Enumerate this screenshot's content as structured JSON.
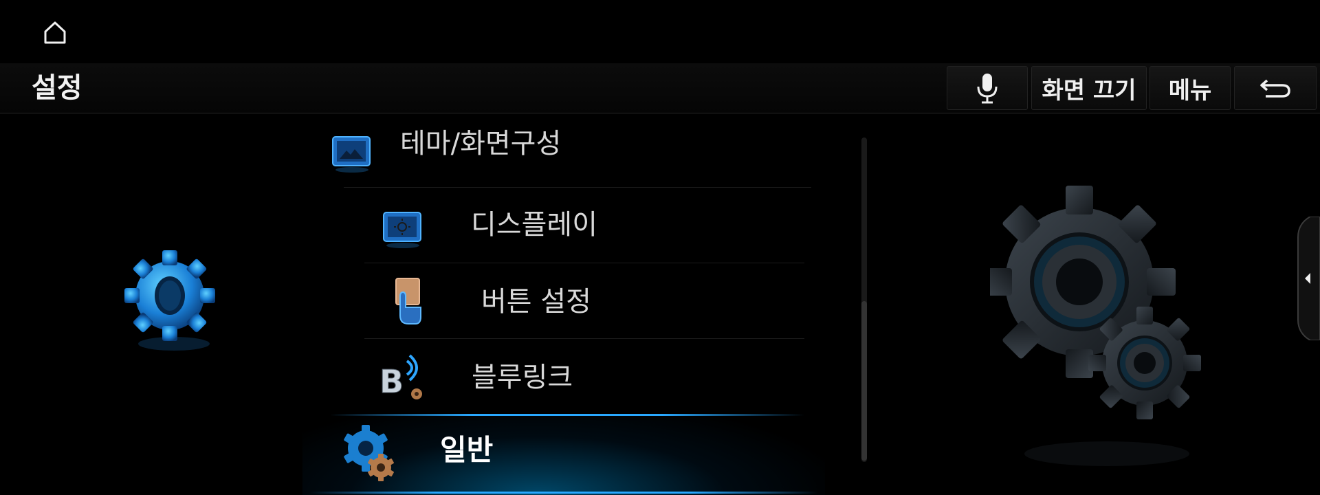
{
  "topbar": {
    "home_icon": "home-icon"
  },
  "header": {
    "title": "설정",
    "buttons": {
      "mic_icon": "microphone-icon",
      "screen_off_label": "화면 끄기",
      "menu_label": "메뉴",
      "back_icon": "back-arrow-icon"
    }
  },
  "menu": {
    "items": [
      {
        "label": "테마/화면구성",
        "icon": "theme-layout-icon"
      },
      {
        "label": "디스플레이",
        "icon": "display-icon"
      },
      {
        "label": "버튼 설정",
        "icon": "button-settings-icon"
      },
      {
        "label": "블루링크",
        "icon": "bluelink-icon"
      },
      {
        "label": "일반",
        "icon": "general-gear-icon",
        "selected": true
      }
    ]
  },
  "colors": {
    "accent": "#29a8ff",
    "background": "#000000",
    "text": "#d9d9d9"
  },
  "side_tab": {
    "icon": "collapse-left-icon"
  }
}
